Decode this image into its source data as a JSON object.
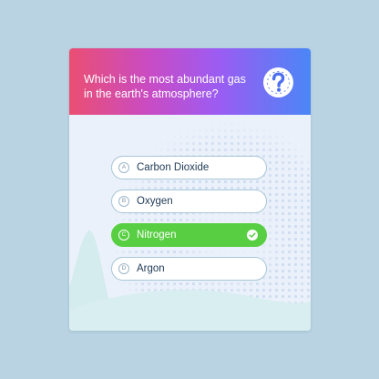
{
  "quiz": {
    "question": "Which is the most abundant gas in the earth's atmosphere?",
    "help_icon": "question-mark-icon",
    "options": [
      {
        "letter": "A",
        "label": "Carbon Dioxide",
        "state": "default"
      },
      {
        "letter": "B",
        "label": "Oxygen",
        "state": "default"
      },
      {
        "letter": "C",
        "label": "Nitrogen",
        "state": "correct",
        "icon": "check-icon"
      },
      {
        "letter": "D",
        "label": "Argon",
        "state": "default"
      }
    ]
  },
  "colors": {
    "page_background": "#b9d3e2",
    "card_background": "#ebf1fa",
    "header_gradient": [
      "#ea4e72",
      "#c84cc6",
      "#9b5cf3",
      "#4a86f6"
    ],
    "correct_option": "#58cf43",
    "option_border": "#a9c6d8",
    "option_text": "#1f3a56"
  }
}
